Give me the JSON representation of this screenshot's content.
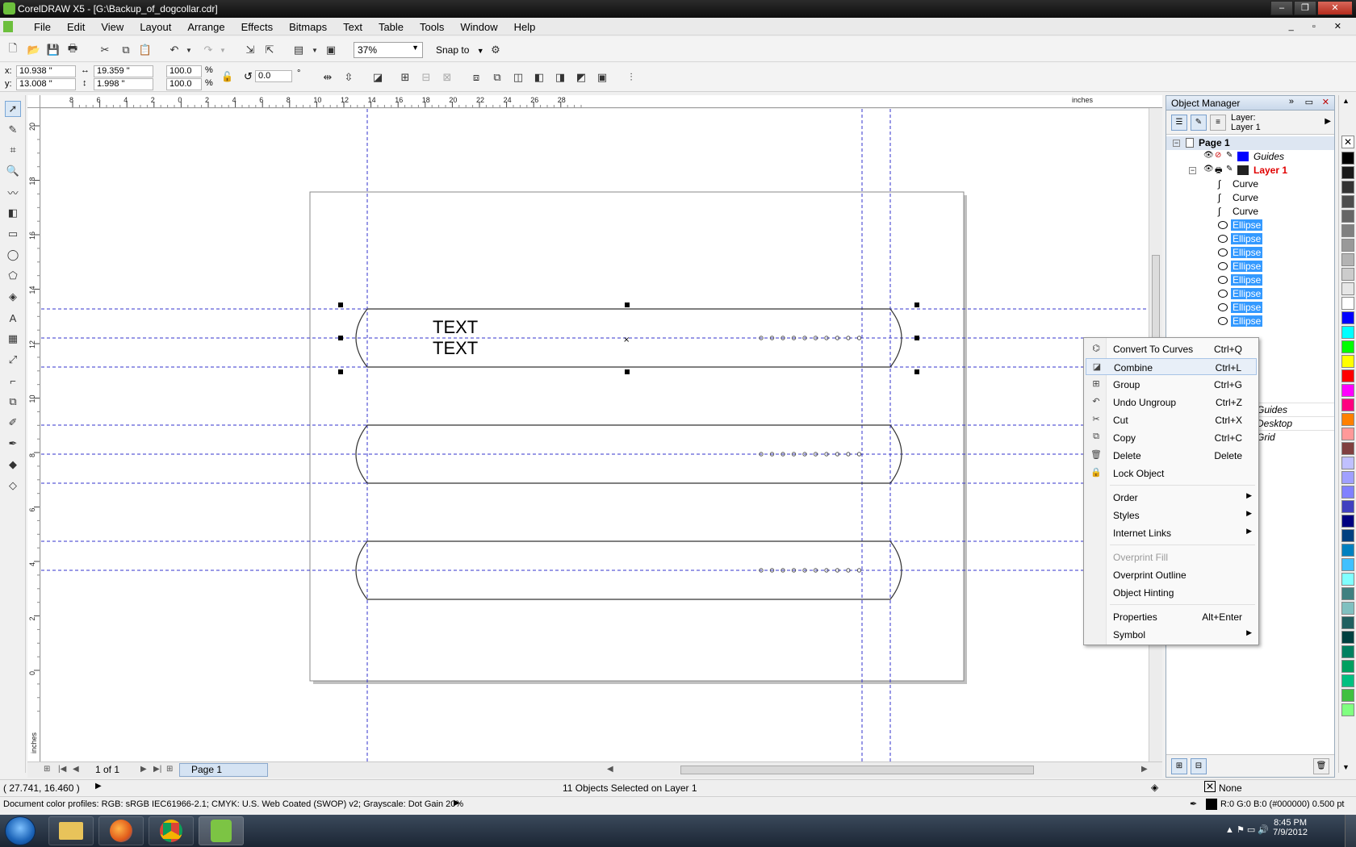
{
  "window": {
    "title": "CorelDRAW X5 - [G:\\Backup_of_dogcollar.cdr]"
  },
  "menu": [
    "File",
    "Edit",
    "View",
    "Layout",
    "Arrange",
    "Effects",
    "Bitmaps",
    "Text",
    "Table",
    "Tools",
    "Window",
    "Help"
  ],
  "toolbar": {
    "zoom": "37%",
    "snap_to": "Snap to"
  },
  "props": {
    "x_label": "x:",
    "x": "10.938 \"",
    "y_label": "y:",
    "y": "13.008 \"",
    "w": "19.359 \"",
    "h": "1.998 \"",
    "scale_w": "100.0",
    "scale_h": "100.0",
    "pct": "%",
    "rotation": "0.0",
    "deg": "°"
  },
  "rulers": {
    "h_ticks": [
      "8",
      "6",
      "4",
      "2",
      "0",
      "2",
      "4",
      "6",
      "8",
      "10",
      "12",
      "14",
      "16",
      "18",
      "20",
      "22",
      "24",
      "26",
      "28"
    ],
    "units": "inches",
    "v_ticks": [
      "20",
      "18",
      "16",
      "14",
      "12",
      "10",
      "8",
      "6",
      "4",
      "2",
      "0"
    ],
    "v_units": "inches"
  },
  "canvas": {
    "text_line1": "TEXT",
    "text_line2": "TEXT"
  },
  "page_nav": {
    "count": "1 of 1",
    "tab": "Page 1"
  },
  "object_manager": {
    "title": "Object Manager",
    "layer_caption": "Layer:",
    "layer_name": "Layer 1",
    "page": "Page 1",
    "guides": "Guides",
    "layer": "Layer 1",
    "curves": [
      "Curve",
      "Curve",
      "Curve"
    ],
    "ellipses": [
      "Ellipse",
      "Ellipse",
      "Ellipse",
      "Ellipse",
      "Ellipse",
      "Ellipse",
      "Ellipse",
      "Ellipse"
    ],
    "master_items": [
      "Guides",
      "Desktop",
      "Grid"
    ]
  },
  "context_menu": [
    {
      "label": "Convert To Curves",
      "key": "Ctrl+Q",
      "icon": "convert-curves-icon"
    },
    {
      "label": "Combine",
      "key": "Ctrl+L",
      "icon": "combine-icon"
    },
    {
      "label": "Group",
      "key": "Ctrl+G",
      "icon": "group-icon"
    },
    {
      "label": "Undo Ungroup",
      "key": "Ctrl+Z",
      "icon": "undo-icon"
    },
    {
      "label": "Cut",
      "key": "Ctrl+X",
      "icon": "scissors-icon"
    },
    {
      "label": "Copy",
      "key": "Ctrl+C",
      "icon": "copy-icon"
    },
    {
      "label": "Delete",
      "key": "Delete",
      "icon": "trash-icon"
    },
    {
      "label": "Lock Object",
      "key": "",
      "icon": "lock-icon"
    },
    {
      "label": "Order",
      "key": "",
      "submenu": true
    },
    {
      "label": "Styles",
      "key": "",
      "submenu": true
    },
    {
      "label": "Internet Links",
      "key": "",
      "submenu": true
    },
    {
      "label": "Overprint Fill",
      "key": "",
      "disabled": true
    },
    {
      "label": "Overprint Outline",
      "key": ""
    },
    {
      "label": "Object Hinting",
      "key": ""
    },
    {
      "label": "Properties",
      "key": "Alt+Enter"
    },
    {
      "label": "Symbol",
      "key": "",
      "submenu": true
    }
  ],
  "status": {
    "coords": "( 27.741, 16.460 )",
    "selection": "11 Objects Selected on Layer 1",
    "fill": "None",
    "color_profiles": "Document color profiles: RGB: sRGB IEC61966-2.1; CMYK: U.S. Web Coated (SWOP) v2; Grayscale: Dot Gain 20%",
    "outline": "R:0 G:0 B:0 (#000000)  0.500 pt"
  },
  "taskbar": {
    "time": "8:45 PM",
    "date": "7/9/2012"
  },
  "colors": {
    "guide": "#3333cc",
    "selection": "#3399ff",
    "layer_red": "#e00000",
    "palette": [
      "#000000",
      "#1a1a1a",
      "#333333",
      "#4d4d4d",
      "#666666",
      "#808080",
      "#999999",
      "#b3b3b3",
      "#cccccc",
      "#e6e6e6",
      "#ffffff",
      "#0000ff",
      "#00ffff",
      "#00ff00",
      "#ffff00",
      "#ff0000",
      "#ff00ff",
      "#ff0080",
      "#ff8000",
      "#ff9999",
      "#804040",
      "#c0c0ff",
      "#a0a0ff",
      "#8080ff",
      "#4040c0",
      "#000080",
      "#004080",
      "#0080c0",
      "#40c0ff",
      "#80ffff",
      "#408080",
      "#80c0c0",
      "#206060",
      "#004040",
      "#008060",
      "#00a060",
      "#00c080",
      "#40c040",
      "#80ff80"
    ]
  }
}
